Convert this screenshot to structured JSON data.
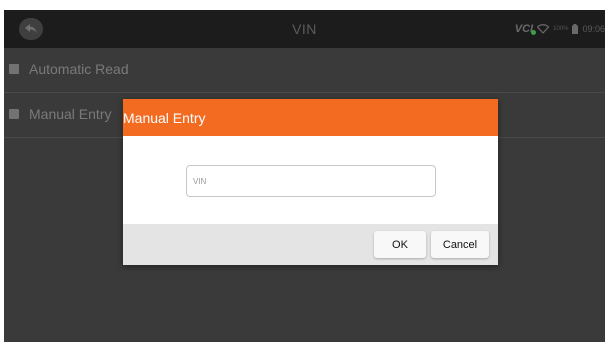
{
  "topbar": {
    "title": "VIN",
    "back_icon": "back-arrow-icon",
    "status": {
      "vci_label": "VCI",
      "battery_pct": "100%",
      "time": "09:06"
    }
  },
  "menu": {
    "items": [
      {
        "label": "Automatic Read"
      },
      {
        "label": "Manual Entry"
      }
    ]
  },
  "dialog": {
    "title": "Manual Entry",
    "vin_placeholder": "VIN",
    "vin_value": "",
    "ok_label": "OK",
    "cancel_label": "Cancel"
  },
  "colors": {
    "accent": "#f26b21",
    "dialog_footer": "#e4e4e4",
    "background": "#3a3a3a",
    "topbar": "#1c1c1c"
  }
}
